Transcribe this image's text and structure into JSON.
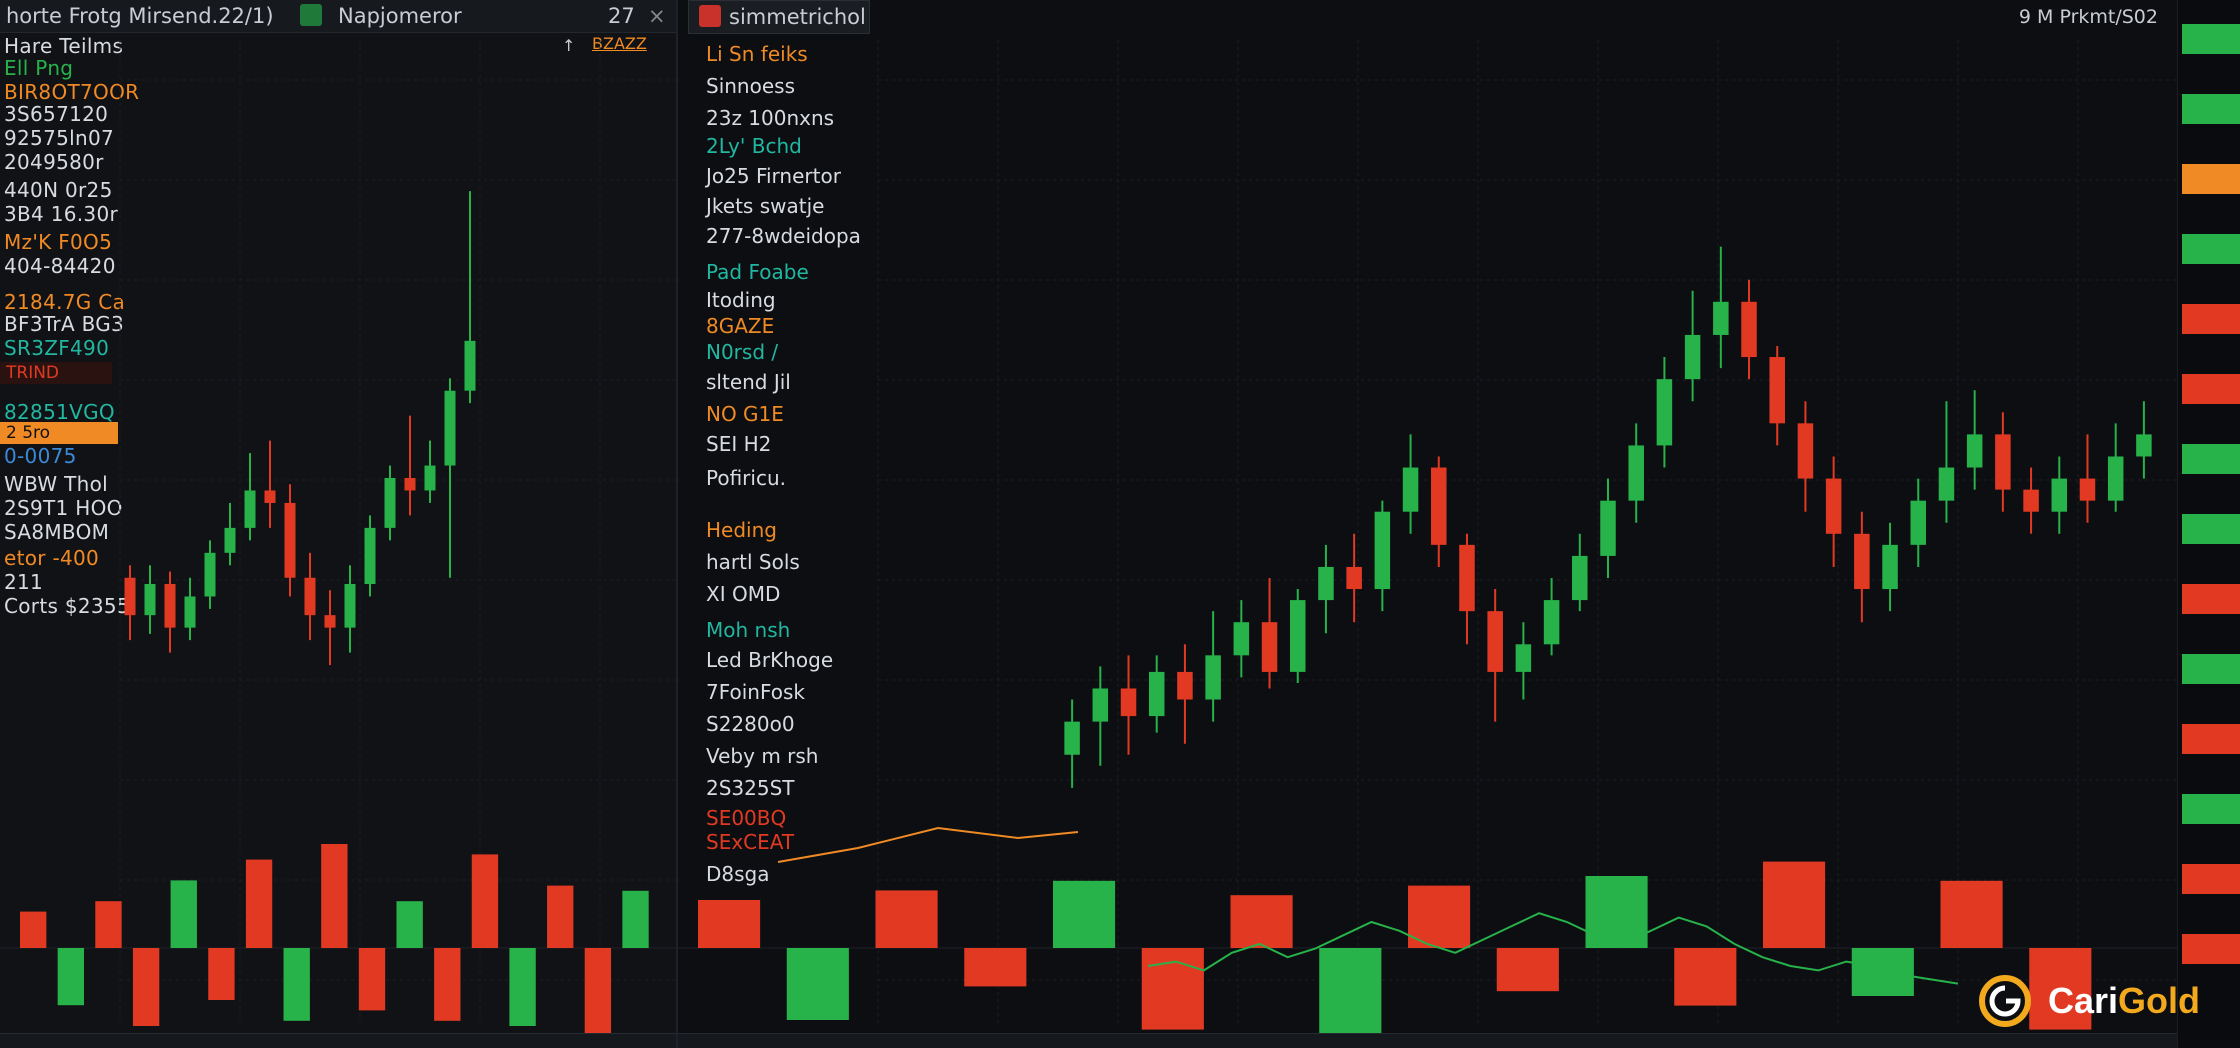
{
  "colors": {
    "up": "#27b24a",
    "down": "#e23a22",
    "accent_orange": "#f08a24",
    "accent_teal": "#21b7a0",
    "grid": "#1b1f26"
  },
  "left_panel": {
    "tab_title": "horte Frotg Mirsend.22/1)",
    "tab_label": "Napjomeror",
    "tab_counter": "27",
    "sub_action": "BZAZZ",
    "rows": [
      {
        "text": "Hare Teilms",
        "color": "#d8dbe0"
      },
      {
        "text": "Ell Png",
        "color": "#27b24a"
      },
      {
        "text": "BIR8OT7OOR",
        "color": "#f08a24"
      },
      {
        "text": "3S657120",
        "color": "#d8dbe0"
      },
      {
        "text": "92575ln07",
        "color": "#d8dbe0"
      },
      {
        "text": "2049580r",
        "color": "#d8dbe0"
      },
      {
        "text": "440N 0r25",
        "color": "#d8dbe0"
      },
      {
        "text": "3B4 16.30r",
        "color": "#d8dbe0"
      },
      {
        "text": "Mz'K F0O5",
        "color": "#f08a24"
      },
      {
        "text": "404-84420",
        "color": "#d8dbe0"
      },
      {
        "text": "2184.7G Ca",
        "color": "#f08a24"
      },
      {
        "text": "BF3TrA BG3",
        "color": "#d8dbe0"
      },
      {
        "text": "SR3ZF490",
        "color": "#21b7a0"
      },
      {
        "text": "82851VGQ",
        "color": "#21b7a0"
      },
      {
        "text": "0-0075",
        "color": "#3a8ad8"
      },
      {
        "text": "WBW Thol",
        "color": "#d8dbe0"
      },
      {
        "text": "2S9T1 HOO",
        "color": "#d8dbe0"
      },
      {
        "text": "SA8MBOM",
        "color": "#d8dbe0"
      },
      {
        "text": "etor -400",
        "color": "#f08a24"
      },
      {
        "text": "211",
        "color": "#d8dbe0"
      },
      {
        "text": "Corts $2355",
        "color": "#d8dbe0"
      }
    ],
    "badges": [
      {
        "text": "TRIND",
        "color": "#e23a22"
      },
      {
        "text": "2 5ro",
        "color": "#f08a24"
      }
    ]
  },
  "main_panel": {
    "tab_title": "simmetrichol",
    "sidebar": [
      {
        "text": "Li Sn feiks",
        "color": "#f08a24"
      },
      {
        "text": "Sinnoess",
        "color": "#d8dbe0"
      },
      {
        "text": "23z 100nxns",
        "color": "#d8dbe0"
      },
      {
        "text": "2Ly' Bchd",
        "color": "#21b7a0"
      },
      {
        "text": "Jo25 Firnertor",
        "color": "#d8dbe0"
      },
      {
        "text": "Jkets swatje",
        "color": "#d8dbe0"
      },
      {
        "text": "277-8wdeidopa",
        "color": "#d8dbe0"
      },
      {
        "text": "Pad Foabe",
        "color": "#21b7a0"
      },
      {
        "text": "Itoding",
        "color": "#d8dbe0"
      },
      {
        "text": "8GAZE",
        "color": "#f08a24"
      },
      {
        "text": "N0rsd /",
        "color": "#21b7a0"
      },
      {
        "text": "sltend Jil",
        "color": "#d8dbe0"
      },
      {
        "text": "NO G1E",
        "color": "#f08a24"
      },
      {
        "text": "SEI H2",
        "color": "#d8dbe0"
      },
      {
        "text": "Pofiricu.",
        "color": "#d8dbe0"
      },
      {
        "text": "Heding",
        "color": "#f08a24"
      },
      {
        "text": "hartl Sols",
        "color": "#d8dbe0"
      },
      {
        "text": "XI OMD",
        "color": "#d8dbe0"
      },
      {
        "text": "Moh nsh",
        "color": "#21b7a0"
      },
      {
        "text": "Led BrKhoge",
        "color": "#d8dbe0"
      },
      {
        "text": "7FoinFosk",
        "color": "#d8dbe0"
      },
      {
        "text": "S2280o0",
        "color": "#d8dbe0"
      },
      {
        "text": "Veby m rsh",
        "color": "#d8dbe0"
      },
      {
        "text": "2S325ST",
        "color": "#d8dbe0"
      },
      {
        "text": "SE00BQ",
        "color": "#e23a22"
      },
      {
        "text": "SExCEAT",
        "color": "#e23a22"
      },
      {
        "text": "D8sga",
        "color": "#d8dbe0"
      }
    ],
    "symbol_header": "9 M Prkmt/S02"
  },
  "price_axis": {
    "tags": [
      {
        "text": "",
        "color": "#27b24a"
      },
      {
        "text": "",
        "color": "#27b24a"
      },
      {
        "text": "",
        "color": "#f08a24"
      },
      {
        "text": "",
        "color": "#27b24a"
      },
      {
        "text": "",
        "color": "#e23a22"
      },
      {
        "text": "",
        "color": "#e23a22"
      },
      {
        "text": "",
        "color": "#27b24a"
      },
      {
        "text": "",
        "color": "#27b24a"
      },
      {
        "text": "",
        "color": "#e23a22"
      },
      {
        "text": "",
        "color": "#27b24a"
      },
      {
        "text": "",
        "color": "#e23a22"
      },
      {
        "text": "",
        "color": "#27b24a"
      },
      {
        "text": "",
        "color": "#e23a22"
      },
      {
        "text": "",
        "color": "#e23a22"
      }
    ]
  },
  "logo": {
    "name_white": "Cari",
    "name_gold": "Gold"
  },
  "chart_data": {
    "type": "candlestick",
    "left_series": [
      {
        "o": 58,
        "c": 52,
        "h": 60,
        "l": 48
      },
      {
        "o": 52,
        "c": 57,
        "h": 60,
        "l": 49
      },
      {
        "o": 57,
        "c": 50,
        "h": 59,
        "l": 46
      },
      {
        "o": 50,
        "c": 55,
        "h": 58,
        "l": 48
      },
      {
        "o": 55,
        "c": 62,
        "h": 64,
        "l": 53
      },
      {
        "o": 62,
        "c": 66,
        "h": 70,
        "l": 60
      },
      {
        "o": 66,
        "c": 72,
        "h": 78,
        "l": 64
      },
      {
        "o": 72,
        "c": 70,
        "h": 80,
        "l": 66
      },
      {
        "o": 70,
        "c": 58,
        "h": 73,
        "l": 55
      },
      {
        "o": 58,
        "c": 52,
        "h": 62,
        "l": 48
      },
      {
        "o": 52,
        "c": 50,
        "h": 56,
        "l": 44
      },
      {
        "o": 50,
        "c": 57,
        "h": 60,
        "l": 46
      },
      {
        "o": 57,
        "c": 66,
        "h": 68,
        "l": 55
      },
      {
        "o": 66,
        "c": 74,
        "h": 76,
        "l": 64
      },
      {
        "o": 74,
        "c": 72,
        "h": 84,
        "l": 68
      },
      {
        "o": 72,
        "c": 76,
        "h": 80,
        "l": 70
      },
      {
        "o": 76,
        "c": 88,
        "h": 90,
        "l": 58
      },
      {
        "o": 88,
        "c": 96,
        "h": 120,
        "l": 86
      }
    ],
    "main_series": [
      {
        "o": 40,
        "c": 46,
        "h": 50,
        "l": 34
      },
      {
        "o": 46,
        "c": 52,
        "h": 56,
        "l": 38
      },
      {
        "o": 52,
        "c": 47,
        "h": 58,
        "l": 40
      },
      {
        "o": 47,
        "c": 55,
        "h": 58,
        "l": 44
      },
      {
        "o": 55,
        "c": 50,
        "h": 60,
        "l": 42
      },
      {
        "o": 50,
        "c": 58,
        "h": 66,
        "l": 46
      },
      {
        "o": 58,
        "c": 64,
        "h": 68,
        "l": 54
      },
      {
        "o": 64,
        "c": 55,
        "h": 72,
        "l": 52
      },
      {
        "o": 55,
        "c": 68,
        "h": 70,
        "l": 53
      },
      {
        "o": 68,
        "c": 74,
        "h": 78,
        "l": 62
      },
      {
        "o": 74,
        "c": 70,
        "h": 80,
        "l": 64
      },
      {
        "o": 70,
        "c": 84,
        "h": 86,
        "l": 66
      },
      {
        "o": 84,
        "c": 92,
        "h": 98,
        "l": 80
      },
      {
        "o": 92,
        "c": 78,
        "h": 94,
        "l": 74
      },
      {
        "o": 78,
        "c": 66,
        "h": 80,
        "l": 60
      },
      {
        "o": 66,
        "c": 55,
        "h": 70,
        "l": 46
      },
      {
        "o": 55,
        "c": 60,
        "h": 64,
        "l": 50
      },
      {
        "o": 60,
        "c": 68,
        "h": 72,
        "l": 58
      },
      {
        "o": 68,
        "c": 76,
        "h": 80,
        "l": 66
      },
      {
        "o": 76,
        "c": 86,
        "h": 90,
        "l": 72
      },
      {
        "o": 86,
        "c": 96,
        "h": 100,
        "l": 82
      },
      {
        "o": 96,
        "c": 108,
        "h": 112,
        "l": 92
      },
      {
        "o": 108,
        "c": 116,
        "h": 124,
        "l": 104
      },
      {
        "o": 116,
        "c": 122,
        "h": 132,
        "l": 110
      },
      {
        "o": 122,
        "c": 112,
        "h": 126,
        "l": 108
      },
      {
        "o": 112,
        "c": 100,
        "h": 114,
        "l": 96
      },
      {
        "o": 100,
        "c": 90,
        "h": 104,
        "l": 84
      },
      {
        "o": 90,
        "c": 80,
        "h": 94,
        "l": 74
      },
      {
        "o": 80,
        "c": 70,
        "h": 84,
        "l": 64
      },
      {
        "o": 70,
        "c": 78,
        "h": 82,
        "l": 66
      },
      {
        "o": 78,
        "c": 86,
        "h": 90,
        "l": 74
      },
      {
        "o": 86,
        "c": 92,
        "h": 104,
        "l": 82
      },
      {
        "o": 92,
        "c": 98,
        "h": 106,
        "l": 88
      },
      {
        "o": 98,
        "c": 88,
        "h": 102,
        "l": 84
      },
      {
        "o": 88,
        "c": 84,
        "h": 92,
        "l": 80
      },
      {
        "o": 84,
        "c": 90,
        "h": 94,
        "l": 80
      },
      {
        "o": 90,
        "c": 86,
        "h": 98,
        "l": 82
      },
      {
        "o": 86,
        "c": 94,
        "h": 100,
        "l": 84
      },
      {
        "o": 94,
        "c": 98,
        "h": 104,
        "l": 90
      }
    ],
    "left_volume": [
      14,
      22,
      18,
      30,
      26,
      20,
      34,
      28,
      40,
      24,
      18,
      28,
      36,
      30,
      24,
      40,
      22
    ],
    "main_volume": [
      20,
      30,
      24,
      16,
      28,
      34,
      22,
      40,
      26,
      18,
      30,
      24,
      36,
      20,
      28,
      34
    ],
    "oscillator": [
      20,
      22,
      18,
      26,
      30,
      24,
      28,
      34,
      40,
      36,
      30,
      26,
      32,
      38,
      44,
      40,
      34,
      30,
      36,
      42,
      38,
      30,
      24,
      20,
      18,
      22,
      20,
      16,
      14,
      12
    ]
  }
}
